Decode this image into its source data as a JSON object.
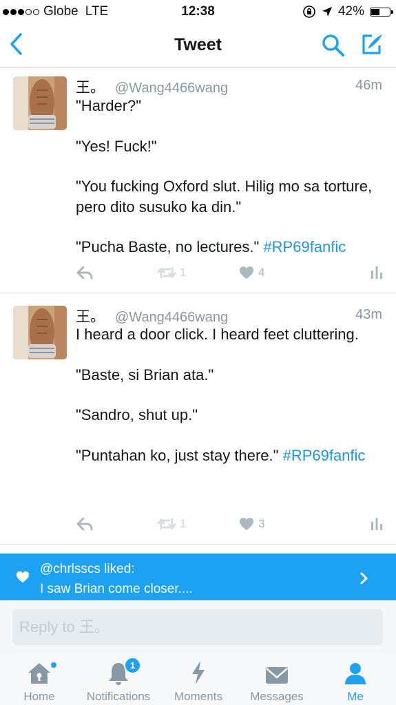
{
  "status_bar": {
    "carrier": "Globe",
    "network": "LTE",
    "time": "12:38",
    "battery": "42%",
    "battery_level": 0.42,
    "signal_bars_filled": 3,
    "signal_bars_total": 5
  },
  "nav": {
    "title": "Tweet",
    "back_icon": "chevron-left-icon",
    "search_icon": "search-icon",
    "compose_icon": "compose-icon"
  },
  "tweets": [
    {
      "name": "王。",
      "handle": "@Wang4466wang",
      "time": "46m",
      "paragraphs": [
        "\"Harder?\"",
        "\"Yes! Fuck!\"",
        "\"You fucking Oxford slut. Hilig mo sa torture, pero dito susuko ka din.\""
      ],
      "last_text": "\"Pucha Baste, no lectures.\" ",
      "hashtag": "#RP69fanfic",
      "retweets": "1",
      "likes": "4"
    },
    {
      "name": "王。",
      "handle": "@Wang4466wang",
      "time": "43m",
      "paragraphs": [
        "I heard a door click. I heard feet cluttering.",
        "\"Baste, si Brian ata.\"",
        "\"Sandro, shut up.\""
      ],
      "last_text": "\"Puntahan ko, just stay there.\" ",
      "hashtag": "#RP69fanfic",
      "retweets": "1",
      "likes": "3"
    }
  ],
  "liked_banner": {
    "line1": "@chrlsscs liked:",
    "line2": "I saw Brian come closer...."
  },
  "reply": {
    "placeholder": "Reply to 王。"
  },
  "tabs": [
    {
      "label": "Home",
      "icon": "home-icon"
    },
    {
      "label": "Notifications",
      "icon": "bell-icon",
      "badge": "1"
    },
    {
      "label": "Moments",
      "icon": "lightning-icon"
    },
    {
      "label": "Messages",
      "icon": "envelope-icon"
    },
    {
      "label": "Me",
      "icon": "person-icon"
    }
  ],
  "colors": {
    "accent": "#1da1f2",
    "hashtag": "#1b95e0",
    "muted": "#8899a6"
  }
}
